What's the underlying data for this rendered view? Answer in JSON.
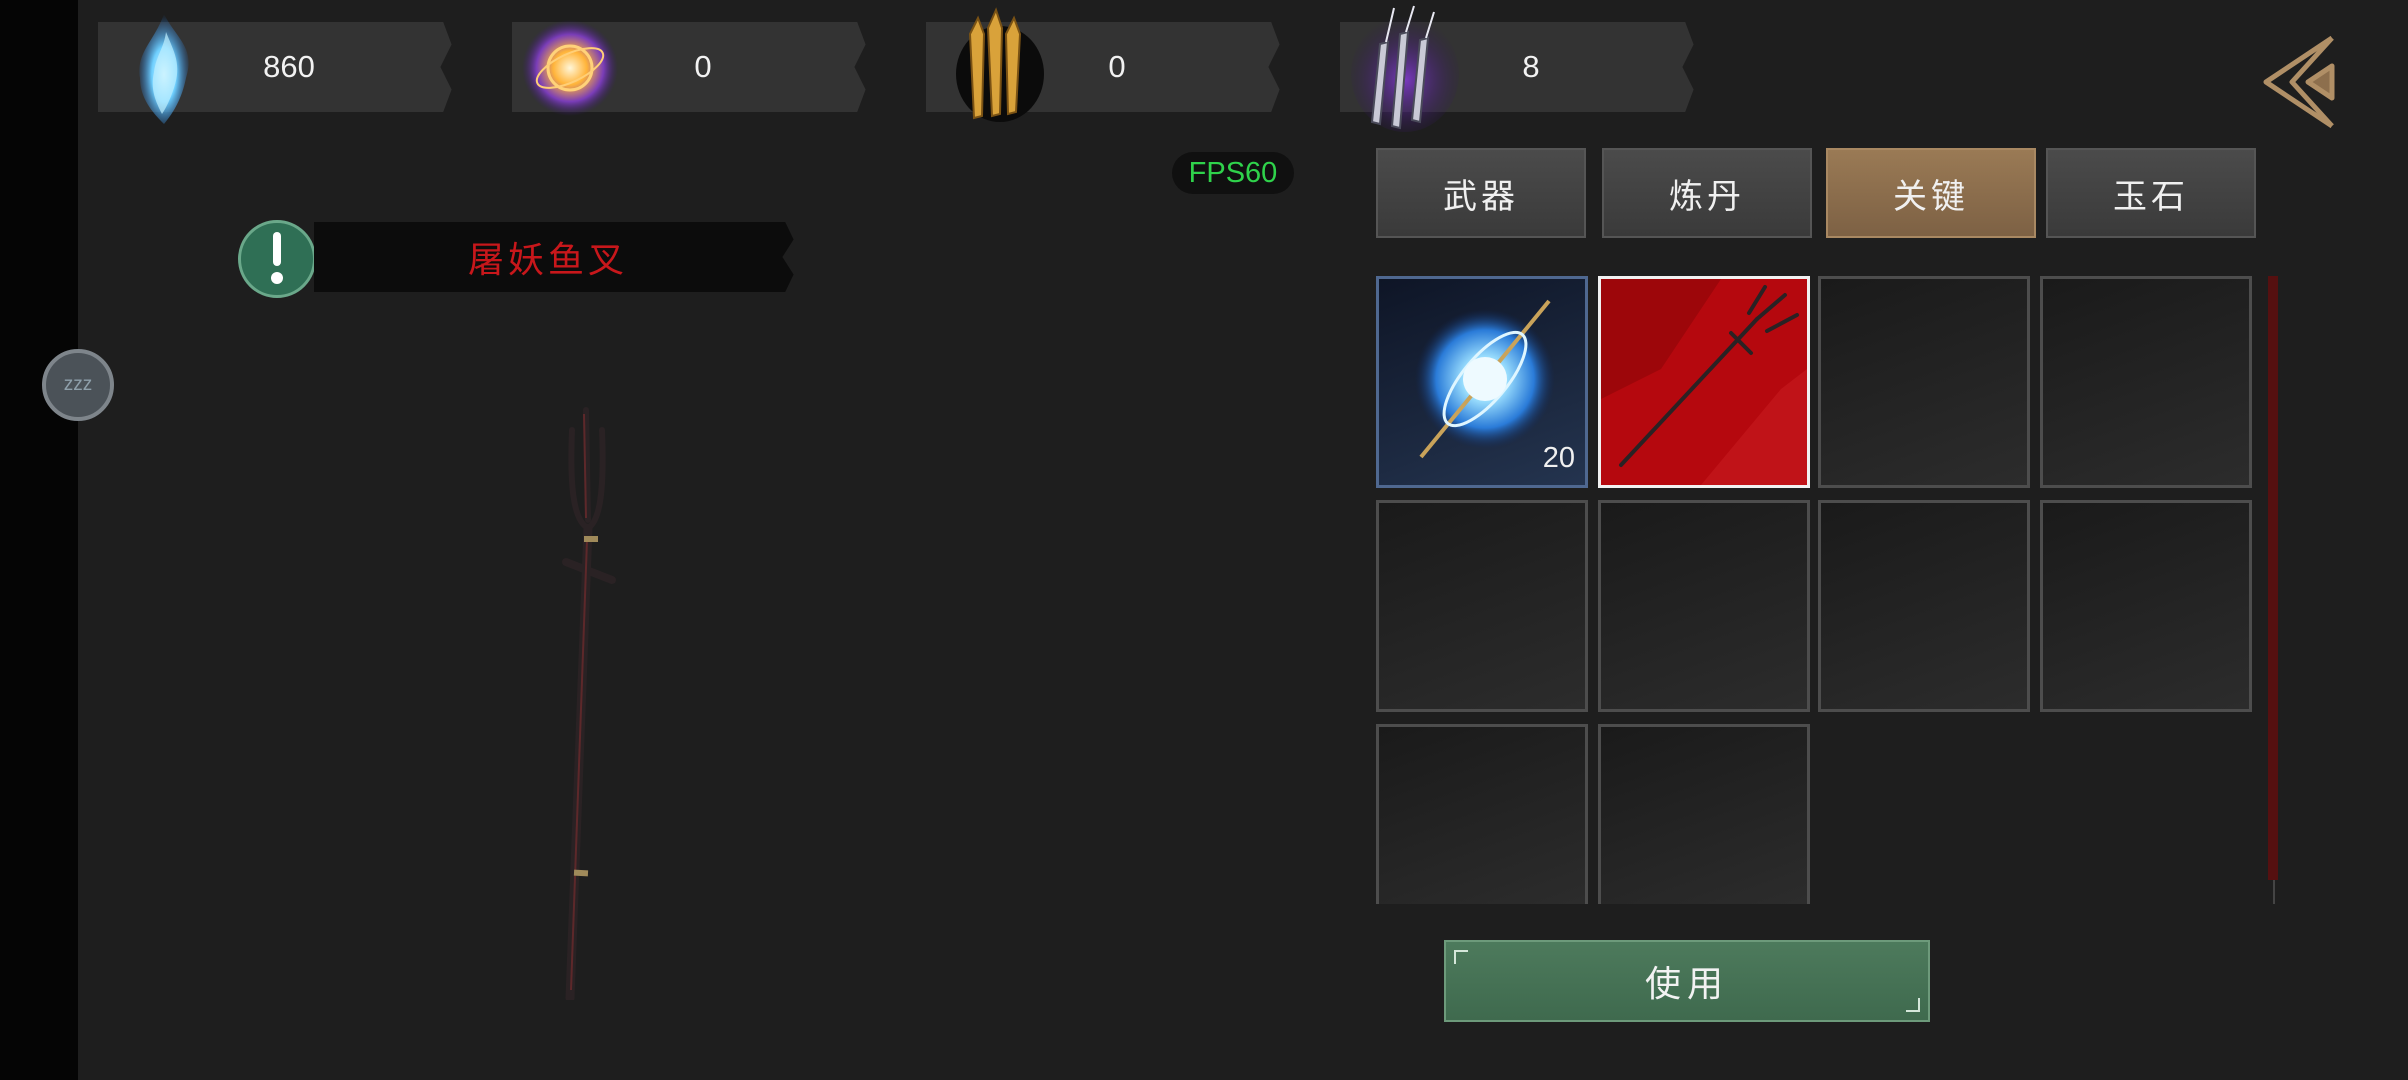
{
  "currencies": [
    {
      "icon": "blue-spirit-flame-icon",
      "value": "860"
    },
    {
      "icon": "golden-orb-icon",
      "value": "0"
    },
    {
      "icon": "golden-tokens-icon",
      "value": "0"
    },
    {
      "icon": "purple-blades-icon",
      "value": "8"
    }
  ],
  "fps": "FPS60",
  "tabs": [
    "武器",
    "炼丹",
    "关键",
    "玉石"
  ],
  "active_tab": "关键",
  "selected_item": {
    "name": "屠妖鱼叉"
  },
  "sleep_button": {
    "label": "zzz"
  },
  "inventory": [
    {
      "icon": "spirit-orb-staff-icon",
      "count": "20",
      "style": "blue"
    },
    {
      "icon": "trident-icon",
      "count": "",
      "style": "selected"
    },
    {
      "icon": "",
      "count": "",
      "style": "empty"
    },
    {
      "icon": "",
      "count": "",
      "style": "empty"
    },
    {
      "icon": "",
      "count": "",
      "style": "empty"
    },
    {
      "icon": "",
      "count": "",
      "style": "empty"
    },
    {
      "icon": "",
      "count": "",
      "style": "empty"
    },
    {
      "icon": "",
      "count": "",
      "style": "empty"
    },
    {
      "icon": "",
      "count": "",
      "style": "empty"
    },
    {
      "icon": "",
      "count": "",
      "style": "empty"
    }
  ],
  "use_button": {
    "label": "使用"
  },
  "colors": {
    "background": "#1e1e1e",
    "item_name": "#c8171b",
    "fps": "#2fd24b",
    "active_tab": "#8b6c4c",
    "use_button": "#46724f",
    "selected_slot": "#b5080e"
  }
}
